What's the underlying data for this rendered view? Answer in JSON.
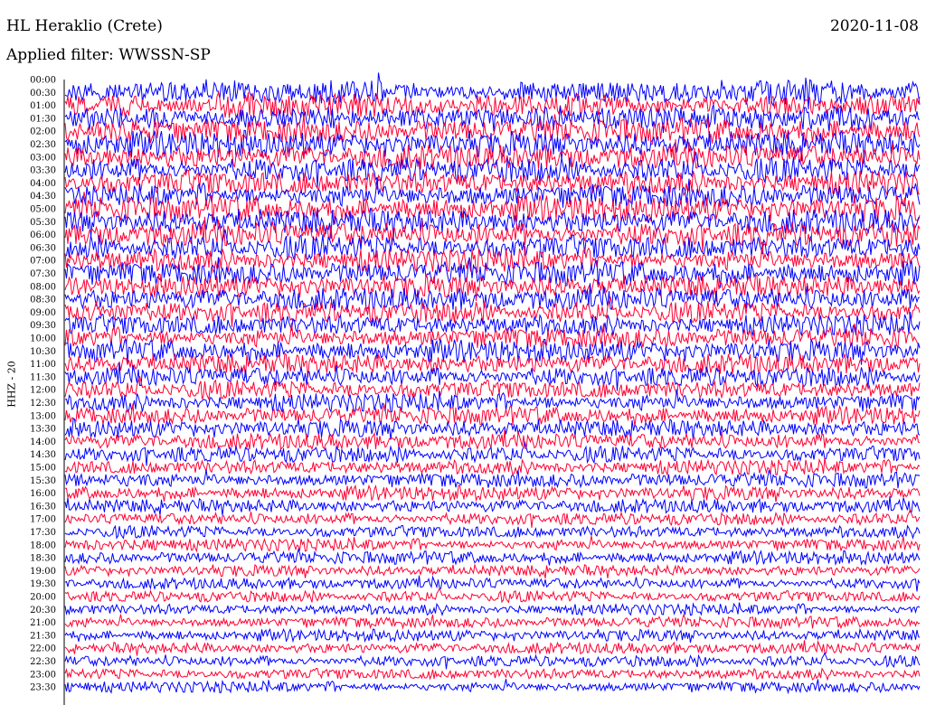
{
  "header": {
    "station": "HL Heraklio (Crete)",
    "date": "2020-11-08",
    "filter": "Applied filter: WWSSN-SP"
  },
  "chart_data": {
    "type": "line",
    "title": "HL Heraklio (Crete)",
    "subtitle": "Applied filter: WWSSN-SP",
    "date": "2020-11-08",
    "ylabel": "HHZ - 20",
    "xlabel": "",
    "y_tick_labels": [
      "00:00",
      "00:30",
      "01:00",
      "01:30",
      "02:00",
      "02:30",
      "03:00",
      "03:30",
      "04:00",
      "04:30",
      "05:00",
      "05:30",
      "06:00",
      "06:30",
      "07:00",
      "07:30",
      "08:00",
      "08:30",
      "09:00",
      "09:30",
      "10:00",
      "10:30",
      "11:00",
      "11:30",
      "12:00",
      "12:30",
      "13:00",
      "13:30",
      "14:00",
      "14:30",
      "15:00",
      "15:30",
      "16:00",
      "16:30",
      "17:00",
      "17:30",
      "18:00",
      "18:30",
      "19:00",
      "19:30",
      "20:00",
      "20:30",
      "21:00",
      "21:30",
      "22:00",
      "22:30",
      "23:00",
      "23:30"
    ],
    "trace_colors": [
      "#0000ff",
      "#ff0033"
    ],
    "series_note": "helicorder: one trace per 30-minute window, alternating colors",
    "relative_amplitude_by_hour": [
      0.95,
      0.95,
      1.0,
      1.0,
      1.0,
      1.0,
      1.0,
      0.95,
      0.9,
      0.85,
      0.85,
      0.8,
      0.75,
      0.7,
      0.65,
      0.6,
      0.55,
      0.5,
      0.5,
      0.45,
      0.45,
      0.45,
      0.45,
      0.45
    ],
    "grid": false
  }
}
